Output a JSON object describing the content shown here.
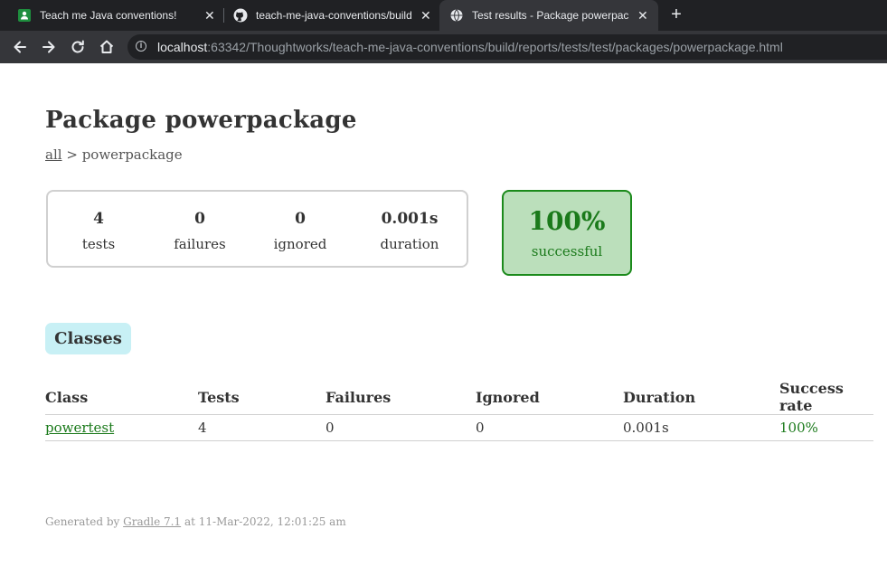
{
  "browser": {
    "tabs": [
      {
        "title": "Teach me Java conventions!",
        "close": "✕"
      },
      {
        "title": "teach-me-java-conventions/build",
        "close": "✕"
      },
      {
        "title": "Test results - Package powerpackage",
        "close": "✕"
      }
    ],
    "new_tab": "+",
    "url_host": "localhost",
    "url_rest": ":63342/Thoughtworks/teach-me-java-conventions/build/reports/tests/test/packages/powerpackage.html"
  },
  "page": {
    "title": "Package powerpackage",
    "breadcrumb": {
      "link": "all",
      "separator": ">",
      "current": "powerpackage"
    },
    "summary": {
      "tests": {
        "value": "4",
        "label": "tests"
      },
      "failures": {
        "value": "0",
        "label": "failures"
      },
      "ignored": {
        "value": "0",
        "label": "ignored"
      },
      "duration": {
        "value": "0.001s",
        "label": "duration"
      }
    },
    "success": {
      "value": "100%",
      "label": "successful"
    },
    "section_tab": "Classes",
    "table": {
      "headers": [
        "Class",
        "Tests",
        "Failures",
        "Ignored",
        "Duration",
        "Success rate"
      ],
      "rows": [
        {
          "class": "powertest",
          "tests": "4",
          "failures": "0",
          "ignored": "0",
          "duration": "0.001s",
          "success_rate": "100%"
        }
      ]
    },
    "footer": {
      "prefix": "Generated by",
      "link": "Gradle 7.1",
      "suffix": "at 11-Mar-2022, 12:01:25 am"
    }
  },
  "colors": {
    "success_green": "#1b7a1b",
    "success_bg": "#bbdfbb",
    "tab_bg": "#c8f0f5",
    "chrome_dark": "#202124",
    "chrome_mid": "#35363a"
  }
}
